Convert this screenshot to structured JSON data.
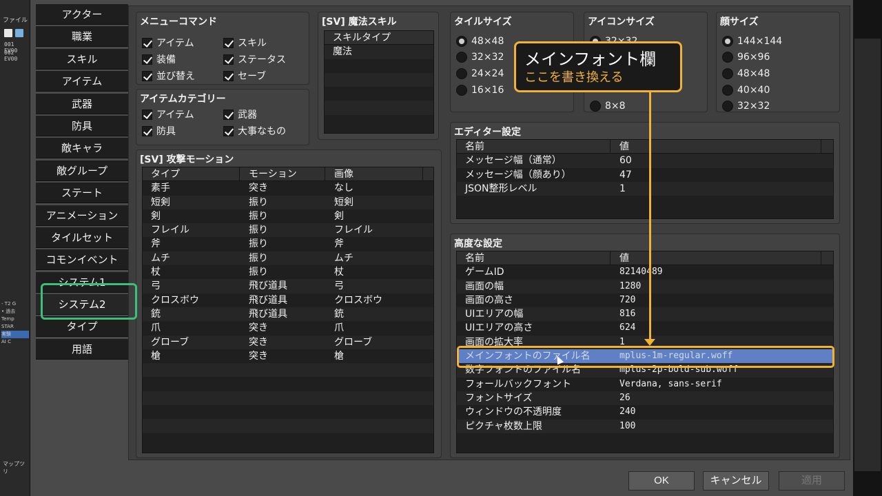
{
  "bg_editor": {
    "menu": "ファイル",
    "events": [
      "001 EV00",
      "002 EV00"
    ],
    "tree": [
      "- T2 G",
      "• 過去",
      "Temp",
      "STAR",
      "実験",
      "AI C"
    ],
    "map_label": "マップツリ"
  },
  "tabs": [
    "アクター",
    "職業",
    "スキル",
    "アイテム",
    "武器",
    "防具",
    "敵キャラ",
    "敵グループ",
    "ステート",
    "アニメーション",
    "タイルセット",
    "コモンイベント",
    "システム1",
    "システム2",
    "タイプ",
    "用語"
  ],
  "menu_commands": {
    "title": "メニューコマンド",
    "items": [
      "アイテム",
      "スキル",
      "装備",
      "ステータス",
      "並び替え",
      "セーブ"
    ]
  },
  "item_category": {
    "title": "アイテムカテゴリー",
    "items": [
      "アイテム",
      "武器",
      "防具",
      "大事なもの"
    ]
  },
  "sv_magic": {
    "title": "[SV] 魔法スキル",
    "header": "スキルタイプ",
    "items": [
      "魔法"
    ]
  },
  "sv_attack": {
    "title": "[SV] 攻撃モーション",
    "headers": [
      "タイプ",
      "モーション",
      "画像"
    ],
    "rows": [
      [
        "素手",
        "突き",
        "なし"
      ],
      [
        "短剣",
        "振り",
        "短剣"
      ],
      [
        "剣",
        "振り",
        "剣"
      ],
      [
        "フレイル",
        "振り",
        "フレイル"
      ],
      [
        "斧",
        "振り",
        "斧"
      ],
      [
        "ムチ",
        "振り",
        "ムチ"
      ],
      [
        "杖",
        "振り",
        "杖"
      ],
      [
        "弓",
        "飛び道具",
        "弓"
      ],
      [
        "クロスボウ",
        "飛び道具",
        "クロスボウ"
      ],
      [
        "銃",
        "飛び道具",
        "銃"
      ],
      [
        "爪",
        "突き",
        "爪"
      ],
      [
        "グローブ",
        "突き",
        "グローブ"
      ],
      [
        "槍",
        "突き",
        "槍"
      ]
    ]
  },
  "tile_size": {
    "title": "タイルサイズ",
    "options": [
      "48×48",
      "32×32",
      "24×24",
      "16×16"
    ]
  },
  "icon_size": {
    "title": "アイコンサイズ",
    "options": [
      "32×32",
      "8×8"
    ]
  },
  "face_size": {
    "title": "顔サイズ",
    "options": [
      "144×144",
      "96×96",
      "48×48",
      "40×40",
      "32×32"
    ]
  },
  "editor_settings": {
    "title": "エディター設定",
    "headers": [
      "名前",
      "値"
    ],
    "rows": [
      [
        "メッセージ幅（通常）",
        "60"
      ],
      [
        "メッセージ幅（顔あり）",
        "47"
      ],
      [
        "JSON整形レベル",
        "1"
      ]
    ]
  },
  "advanced_settings": {
    "title": "高度な設定",
    "headers": [
      "名前",
      "値"
    ],
    "rows": [
      [
        "ゲームID",
        "82140489"
      ],
      [
        "画面の幅",
        "1280"
      ],
      [
        "画面の高さ",
        "720"
      ],
      [
        "UIエリアの幅",
        "816"
      ],
      [
        "UIエリアの高さ",
        "624"
      ],
      [
        "画面の拡大率",
        "1"
      ],
      [
        "メインフォントのファイル名",
        "mplus-1m-regular.woff"
      ],
      [
        "数字フォントのファイル名",
        "mplus-2p-bold-sub.woff"
      ],
      [
        "フォールバックフォント",
        "Verdana, sans-serif"
      ],
      [
        "フォントサイズ",
        "26"
      ],
      [
        "ウィンドウの不透明度",
        "240"
      ],
      [
        "ピクチャ枚数上限",
        "100"
      ]
    ]
  },
  "buttons": {
    "ok": "OK",
    "cancel": "キャンセル",
    "apply": "適用"
  },
  "callout": {
    "title": "メインフォント欄",
    "subtitle": "ここを書き換える"
  },
  "colors": {
    "accent_orange": "#f2b233",
    "accent_green": "#3dbf7b",
    "selection": "#5f80c4"
  }
}
